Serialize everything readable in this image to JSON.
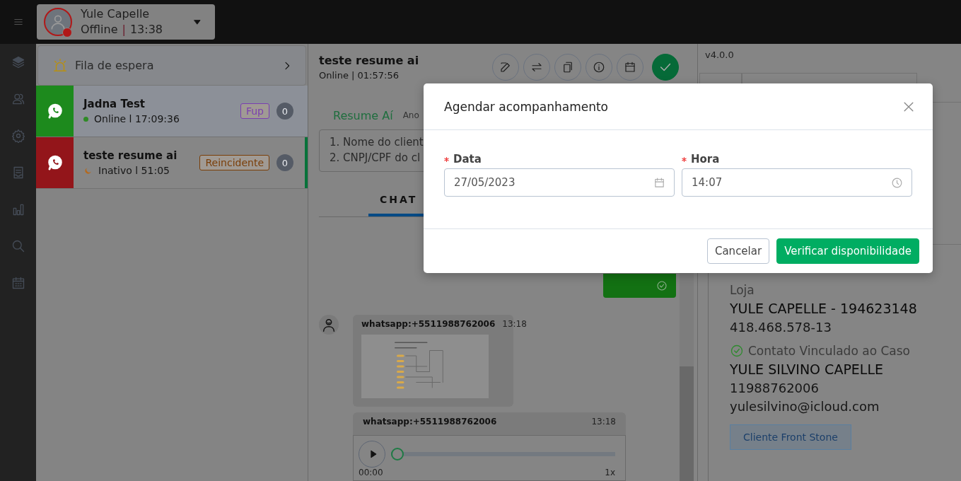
{
  "top_bar": {
    "user_name": "Yule Capelle",
    "status": "Offline",
    "separator": "|",
    "time": "13:38"
  },
  "queue": {
    "header": "Fila de espera",
    "conversations": [
      {
        "name": "Jadna Test",
        "kind": "online",
        "status": "Online l 17:09:36",
        "tag": {
          "label": "Fup",
          "color": "#7a3fb0"
        },
        "count": "0",
        "color": "#1d8a1d",
        "selected": false
      },
      {
        "name": "teste resume ai",
        "kind": "inactive",
        "status": "Inativo l 51:05",
        "tag": {
          "label": "Reincidente",
          "color": "#7a3e08"
        },
        "count": "0",
        "color": "#93151a",
        "selected": true
      }
    ]
  },
  "chat": {
    "title": "teste resume ai",
    "status": "Online | 01:57:56",
    "top_tabs": [
      {
        "label": "Resume Aí",
        "selected": true
      },
      {
        "label": "Ano",
        "selected": false
      }
    ],
    "summary_lines": [
      "1. Nome do client",
      "2. CNPJ/CPF do cl"
    ],
    "tabs": [
      {
        "label": "CHAT",
        "selected": true
      }
    ],
    "messages": [
      {
        "kind": "sent"
      },
      {
        "kind": "image",
        "sender": "whatsapp:+5511988762006",
        "time": "13:18"
      },
      {
        "kind": "audio",
        "sender": "whatsapp:+5511988762006",
        "time": "13:18",
        "position": "00:00",
        "speed": "1x",
        "level": 0
      }
    ]
  },
  "details": {
    "version": "v4.0.0",
    "store_label": "Loja",
    "store_name": "YULE CAPELLE - 194623148",
    "document": "418.468.578-13",
    "contact_label": "Contato Vinculado ao Caso",
    "contact_name": "YULE SILVINO CAPELLE",
    "phone": "11988762006",
    "email": "yulesilvino@icloud.com",
    "tag_button": "Cliente Front Stone"
  },
  "modal": {
    "title": "Agendar acompanhamento",
    "fields": [
      {
        "kind": "date",
        "label": "Data",
        "required": true,
        "value": "27/05/2023"
      },
      {
        "kind": "time",
        "label": "Hora",
        "required": true,
        "value": "14:07"
      }
    ],
    "buttons": [
      {
        "kind": "secondary",
        "label": "Cancelar"
      },
      {
        "kind": "primary",
        "label": "Verificar disponibilidade"
      }
    ]
  }
}
